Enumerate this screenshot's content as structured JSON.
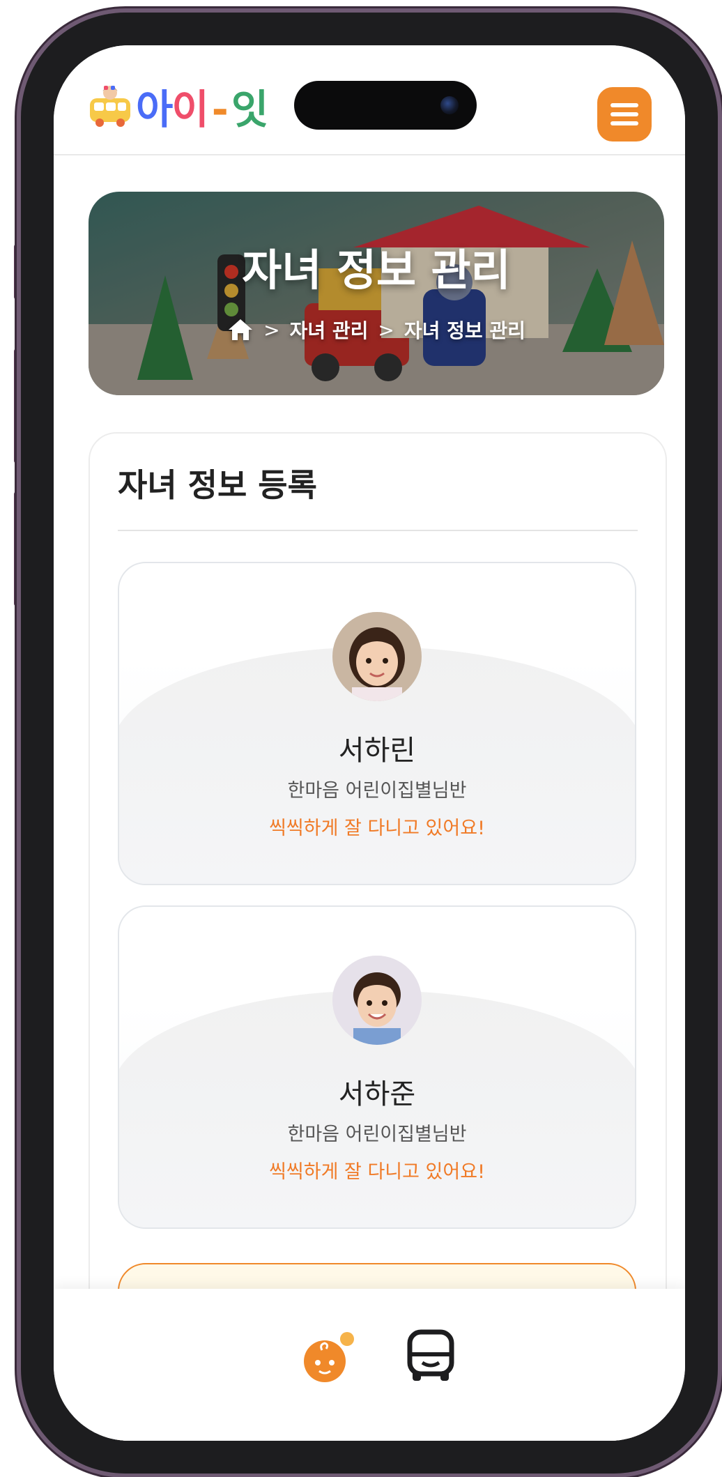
{
  "header": {
    "logo_text": [
      "아",
      "이",
      "-",
      "잇"
    ],
    "logo_colors": [
      "#4a6cf7",
      "#ef4e6a",
      "#f08a2a",
      "#3aa56b"
    ],
    "menu_icon": "hamburger-icon",
    "accent": "#f0892a"
  },
  "hero": {
    "title": "자녀 정보 관리",
    "breadcrumb": [
      "자녀 관리",
      "자녀 정보 관리"
    ],
    "home_icon": "home-icon",
    "separator": ">"
  },
  "card": {
    "title": "자녀 정보 등록",
    "children": [
      {
        "name": "서하린",
        "class": "한마음 어린이집별님반",
        "status": "씩씩하게 잘 다니고 있어요!"
      },
      {
        "name": "서하준",
        "class": "한마음 어린이집별님반",
        "status": "씩씩하게 잘 다니고 있어요!"
      }
    ],
    "status_color": "#f07a26"
  },
  "tabbar": {
    "items": [
      {
        "icon": "child-face-icon",
        "active": true
      },
      {
        "icon": "bus-icon",
        "active": false
      }
    ]
  }
}
